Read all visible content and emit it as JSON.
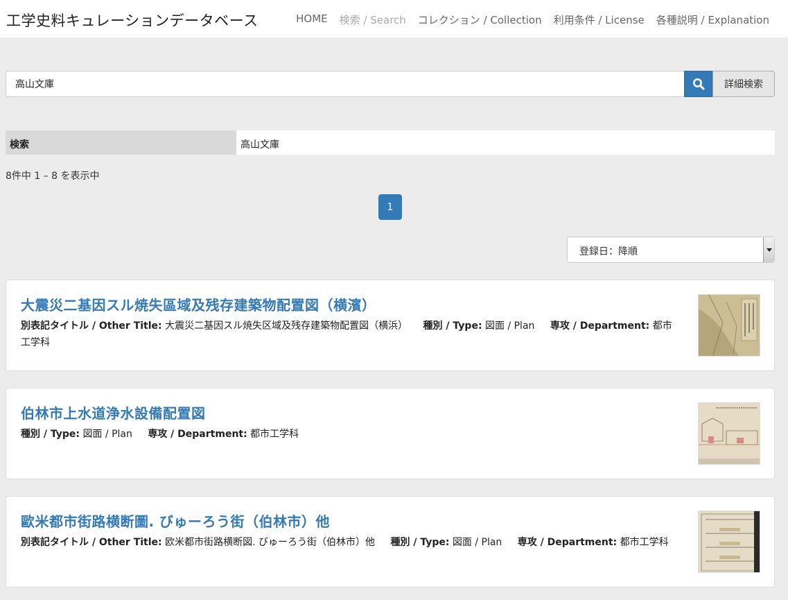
{
  "brand": "工学史料キュレーションデータベース",
  "nav": [
    {
      "label": "HOME",
      "active": false
    },
    {
      "label": "検索 / Search",
      "active": true
    },
    {
      "label": "コレクション / Collection",
      "active": false
    },
    {
      "label": "利用条件 / License",
      "active": false
    },
    {
      "label": "各種説明 / Explanation",
      "active": false
    }
  ],
  "search": {
    "value": "高山文庫",
    "button_icon": "search-icon",
    "advanced_label": "詳細検索"
  },
  "criteria": {
    "key": "検索",
    "value": "高山文庫"
  },
  "results_count": "8件中 1 – 8 を表示中",
  "pagination": {
    "current": "1"
  },
  "sort": {
    "selected": "登録日：降順"
  },
  "labels": {
    "other_title": "別表記タイトル / Other Title:",
    "type": "種別 / Type:",
    "department": "専攻 / Department:"
  },
  "results": [
    {
      "title": "大震災二基因スル焼失區域及残存建築物配置図（横濱）",
      "other_title": "大震災二基因スル焼失区域及残存建築物配置図（横浜）",
      "type": "図面 / Plan",
      "department": "都市工学科"
    },
    {
      "title": "伯林市上水道浄水設備配置図",
      "other_title": "",
      "type": "図面 / Plan",
      "department": "都市工学科"
    },
    {
      "title": "歐米都市街路横断圖. びゅーろう街（伯林市）他",
      "other_title": "欧米都市街路横断図. びゅーろう街（伯林市）他",
      "type": "図面 / Plan",
      "department": "都市工学科"
    }
  ],
  "colors": {
    "accent": "#337ab7",
    "background": "#ececec"
  }
}
